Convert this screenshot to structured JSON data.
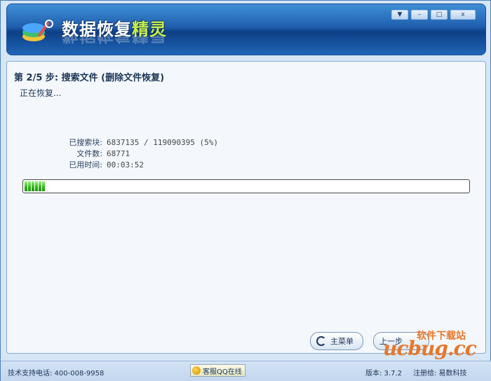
{
  "app": {
    "title_main": "数据恢复",
    "title_accent": "精灵"
  },
  "window_controls": {
    "menu": "▼",
    "minimize": "–",
    "maximize": "□",
    "close": "x"
  },
  "step": {
    "title": "第 2/5 步: 搜索文件 (删除文件恢复)",
    "status": "正在恢复..."
  },
  "info": [
    {
      "label": "已搜索块:",
      "value": "6837135 / 119090395 (5%)"
    },
    {
      "label": "文件数:",
      "value": "68771"
    },
    {
      "label": "已用时间:",
      "value": "00:03:52"
    }
  ],
  "progress": {
    "percent": 5
  },
  "buttons": {
    "main_menu": "主菜单",
    "prev": "上一步"
  },
  "watermark": {
    "site_cn": "软件下载站",
    "site_en": "ucbug.cc"
  },
  "footer": {
    "support": "技术支持电话: 400-008-9958",
    "qq": "客服QQ在线",
    "version": "版本: 3.7.2",
    "registered": "注册给: 易数科技"
  },
  "colors": {
    "banner": "#1f5fae",
    "accent": "#c8f04a",
    "progress": "#2fb51a",
    "watermark": "#e8772a"
  },
  "icons": {
    "logo": "data-recovery-logo-icon",
    "main_menu": "refresh-icon",
    "qq": "qq-icon"
  }
}
